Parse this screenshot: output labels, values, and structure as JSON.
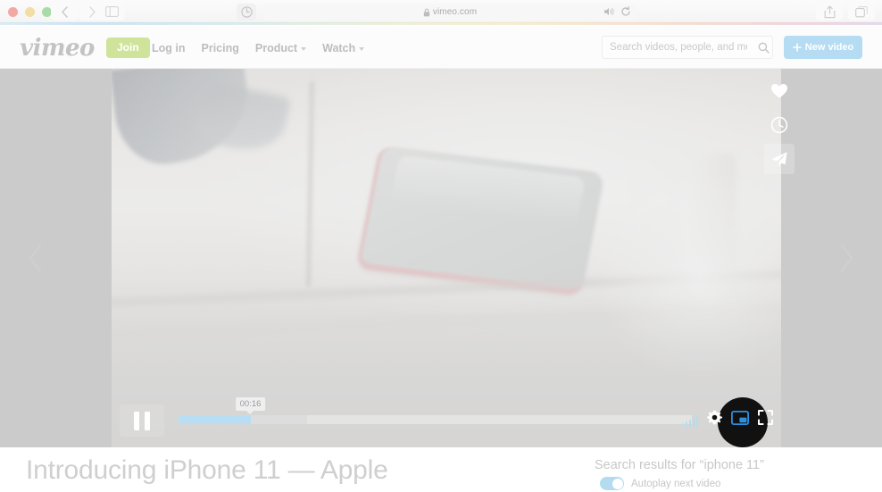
{
  "browser": {
    "url": "vimeo.com",
    "lock_icon": "lock-icon",
    "back_icon": "chevron-left-icon",
    "forward_icon": "chevron-right-icon",
    "sidebar_icon": "sidebar-toggle-icon",
    "shield_icon": "privacy-shield-icon",
    "speaker_icon": "speaker-icon",
    "reload_icon": "reload-icon",
    "share_icon": "share-icon",
    "tabs_icon": "show-tabs-icon",
    "traffic_lights": [
      "close",
      "minimize",
      "maximize"
    ]
  },
  "header": {
    "logo": "vimeo",
    "join_label": "Join",
    "links": [
      {
        "label": "Log in",
        "caret": false
      },
      {
        "label": "Pricing",
        "caret": false
      },
      {
        "label": "Product",
        "caret": true
      },
      {
        "label": "Watch",
        "caret": true
      }
    ],
    "search_placeholder": "Search videos, people, and more",
    "search_value": "",
    "search_icon": "search-icon",
    "new_video_label": "New video",
    "new_video_icon": "plus-icon",
    "join_color": "#cfe49a",
    "new_video_color": "#b5dcf2"
  },
  "player": {
    "prev_icon": "chevron-left-icon",
    "next_icon": "chevron-right-icon",
    "actions": [
      {
        "name": "like-icon",
        "hovered": false
      },
      {
        "name": "watch-later-clock-icon",
        "hovered": false
      },
      {
        "name": "share-paper-plane-icon",
        "hovered": true
      }
    ],
    "controls": {
      "play_pause_state": "pause",
      "time_tooltip": "00:16",
      "played_percent": 14,
      "buffered_percent": 25,
      "volume_icon": "volume-bars-icon",
      "settings_icon": "gear-icon",
      "pip_icon": "picture-in-picture-icon",
      "fullscreen_icon": "fullscreen-icon",
      "pip_active_color": "#2b90e0",
      "progress_fill_color": "#b9def3"
    }
  },
  "bottom": {
    "video_title": "Introducing iPhone 11 — Apple",
    "search_results_label": "Search results for “iphone 11”",
    "autoplay_label": "Autoplay next video",
    "autoplay_enabled": true,
    "toggle_color": "#b4dcf1"
  }
}
